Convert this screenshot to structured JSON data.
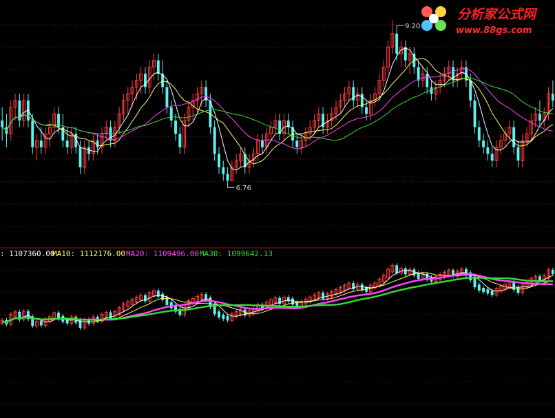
{
  "watermark": {
    "title": "分析家公式网",
    "url": "www.88gs.com"
  },
  "colors": {
    "background": "#000000",
    "grid": "#7a1212",
    "divider": "#a01414",
    "up": "#ff3c3c",
    "down": "#5ff0f0",
    "ma_short": "#ffffff",
    "ma10": "#ffff66",
    "ma20": "#ff44ff",
    "ma30": "#33dd33",
    "annotation": "#d8d8d8",
    "watermark_title": "#ff2020",
    "watermark_url": "#ff3030"
  },
  "chart_data": [
    {
      "type": "candlestick",
      "panel": "price",
      "ylim": [
        6.0,
        9.4
      ],
      "annotations": [
        {
          "label": "9.20",
          "index": 91
        },
        {
          "label": "6.76",
          "index": 52
        }
      ],
      "candles": [
        [
          7.7,
          7.9,
          7.4,
          7.6
        ],
        [
          7.6,
          7.8,
          7.3,
          7.5
        ],
        [
          7.5,
          8.0,
          7.4,
          7.9
        ],
        [
          7.9,
          8.1,
          7.7,
          8.0
        ],
        [
          8.0,
          8.1,
          7.6,
          7.7
        ],
        [
          7.7,
          8.1,
          7.6,
          8.0
        ],
        [
          8.0,
          8.1,
          7.6,
          7.7
        ],
        [
          7.7,
          7.8,
          7.2,
          7.3
        ],
        [
          7.3,
          7.5,
          7.1,
          7.4
        ],
        [
          7.4,
          7.6,
          7.2,
          7.3
        ],
        [
          7.3,
          7.6,
          7.2,
          7.5
        ],
        [
          7.5,
          7.7,
          7.3,
          7.6
        ],
        [
          7.6,
          7.9,
          7.5,
          7.8
        ],
        [
          7.8,
          7.9,
          7.5,
          7.6
        ],
        [
          7.6,
          7.8,
          7.3,
          7.4
        ],
        [
          7.4,
          7.6,
          7.2,
          7.3
        ],
        [
          7.3,
          7.6,
          7.2,
          7.5
        ],
        [
          7.5,
          7.6,
          7.2,
          7.3
        ],
        [
          7.3,
          7.4,
          6.9,
          7.0
        ],
        [
          7.0,
          7.4,
          6.9,
          7.3
        ],
        [
          7.3,
          7.4,
          7.1,
          7.2
        ],
        [
          7.2,
          7.5,
          7.1,
          7.4
        ],
        [
          7.4,
          7.5,
          7.2,
          7.3
        ],
        [
          7.3,
          7.6,
          7.2,
          7.5
        ],
        [
          7.5,
          7.7,
          7.4,
          7.6
        ],
        [
          7.6,
          7.7,
          7.3,
          7.4
        ],
        [
          7.4,
          7.7,
          7.3,
          7.6
        ],
        [
          7.6,
          7.9,
          7.5,
          7.8
        ],
        [
          7.8,
          8.1,
          7.7,
          8.0
        ],
        [
          8.0,
          8.2,
          7.8,
          8.1
        ],
        [
          8.1,
          8.3,
          7.9,
          8.2
        ],
        [
          8.2,
          8.4,
          8.0,
          8.3
        ],
        [
          8.3,
          8.5,
          8.1,
          8.4
        ],
        [
          8.4,
          8.5,
          8.1,
          8.2
        ],
        [
          8.2,
          8.6,
          8.1,
          8.5
        ],
        [
          8.5,
          8.7,
          8.3,
          8.6
        ],
        [
          8.6,
          8.7,
          8.3,
          8.4
        ],
        [
          8.4,
          8.6,
          8.1,
          8.2
        ],
        [
          8.2,
          8.3,
          7.8,
          7.9
        ],
        [
          7.9,
          8.0,
          7.6,
          7.7
        ],
        [
          7.7,
          7.8,
          7.4,
          7.5
        ],
        [
          7.5,
          7.6,
          7.2,
          7.3
        ],
        [
          7.3,
          7.8,
          7.2,
          7.7
        ],
        [
          7.7,
          8.0,
          7.6,
          7.9
        ],
        [
          7.9,
          8.1,
          7.7,
          8.0
        ],
        [
          8.0,
          8.2,
          7.8,
          8.1
        ],
        [
          8.1,
          8.3,
          7.9,
          8.2
        ],
        [
          8.2,
          8.3,
          7.9,
          8.0
        ],
        [
          8.0,
          8.1,
          7.5,
          7.6
        ],
        [
          7.6,
          7.7,
          7.1,
          7.2
        ],
        [
          7.2,
          7.3,
          6.9,
          7.0
        ],
        [
          7.0,
          7.1,
          6.8,
          6.9
        ],
        [
          6.9,
          7.0,
          6.76,
          6.8
        ],
        [
          6.8,
          7.1,
          6.8,
          7.0
        ],
        [
          7.0,
          7.2,
          6.9,
          7.1
        ],
        [
          7.1,
          7.3,
          7.0,
          7.2
        ],
        [
          7.2,
          7.3,
          6.9,
          7.0
        ],
        [
          7.0,
          7.2,
          6.9,
          7.1
        ],
        [
          7.1,
          7.3,
          7.0,
          7.2
        ],
        [
          7.2,
          7.5,
          7.1,
          7.4
        ],
        [
          7.4,
          7.5,
          7.2,
          7.3
        ],
        [
          7.3,
          7.6,
          7.2,
          7.5
        ],
        [
          7.5,
          7.7,
          7.4,
          7.6
        ],
        [
          7.6,
          7.8,
          7.5,
          7.7
        ],
        [
          7.7,
          7.8,
          7.4,
          7.5
        ],
        [
          7.5,
          7.8,
          7.4,
          7.7
        ],
        [
          7.7,
          7.8,
          7.5,
          7.6
        ],
        [
          7.6,
          7.7,
          7.3,
          7.4
        ],
        [
          7.4,
          7.5,
          7.2,
          7.3
        ],
        [
          7.3,
          7.5,
          7.2,
          7.4
        ],
        [
          7.4,
          7.6,
          7.3,
          7.5
        ],
        [
          7.5,
          7.7,
          7.4,
          7.6
        ],
        [
          7.6,
          7.8,
          7.5,
          7.7
        ],
        [
          7.7,
          7.9,
          7.6,
          7.8
        ],
        [
          7.8,
          7.9,
          7.5,
          7.6
        ],
        [
          7.6,
          7.8,
          7.5,
          7.7
        ],
        [
          7.7,
          7.9,
          7.6,
          7.8
        ],
        [
          7.8,
          8.0,
          7.7,
          7.9
        ],
        [
          7.9,
          8.1,
          7.8,
          8.0
        ],
        [
          8.0,
          8.2,
          7.9,
          8.1
        ],
        [
          8.1,
          8.3,
          8.0,
          8.2
        ],
        [
          8.2,
          8.3,
          7.9,
          8.0
        ],
        [
          8.0,
          8.2,
          7.9,
          8.1
        ],
        [
          8.1,
          8.2,
          7.8,
          7.9
        ],
        [
          7.9,
          8.0,
          7.7,
          7.8
        ],
        [
          7.8,
          8.1,
          7.7,
          8.0
        ],
        [
          8.0,
          8.2,
          7.9,
          8.1
        ],
        [
          8.1,
          8.4,
          8.0,
          8.3
        ],
        [
          8.3,
          8.6,
          8.2,
          8.5
        ],
        [
          8.5,
          8.9,
          8.4,
          8.8
        ],
        [
          8.8,
          9.2,
          8.7,
          9.0
        ],
        [
          9.0,
          9.1,
          8.6,
          8.7
        ],
        [
          8.7,
          8.9,
          8.5,
          8.8
        ],
        [
          8.8,
          8.9,
          8.5,
          8.6
        ],
        [
          8.6,
          8.8,
          8.4,
          8.7
        ],
        [
          8.7,
          8.8,
          8.4,
          8.5
        ],
        [
          8.5,
          8.6,
          8.2,
          8.3
        ],
        [
          8.3,
          8.5,
          8.2,
          8.4
        ],
        [
          8.4,
          8.5,
          8.1,
          8.2
        ],
        [
          8.2,
          8.3,
          8.0,
          8.1
        ],
        [
          8.1,
          8.3,
          8.0,
          8.2
        ],
        [
          8.2,
          8.4,
          8.1,
          8.3
        ],
        [
          8.3,
          8.5,
          8.2,
          8.4
        ],
        [
          8.4,
          8.6,
          8.3,
          8.5
        ],
        [
          8.5,
          8.6,
          8.2,
          8.3
        ],
        [
          8.3,
          8.5,
          8.2,
          8.4
        ],
        [
          8.4,
          8.6,
          8.3,
          8.5
        ],
        [
          8.5,
          8.6,
          8.2,
          8.3
        ],
        [
          8.3,
          8.4,
          7.9,
          8.0
        ],
        [
          8.0,
          8.1,
          7.5,
          7.6
        ],
        [
          7.6,
          7.7,
          7.3,
          7.4
        ],
        [
          7.4,
          7.5,
          7.2,
          7.3
        ],
        [
          7.3,
          7.4,
          7.1,
          7.2
        ],
        [
          7.2,
          7.3,
          7.0,
          7.1
        ],
        [
          7.1,
          7.4,
          7.0,
          7.3
        ],
        [
          7.3,
          7.5,
          7.2,
          7.4
        ],
        [
          7.4,
          7.6,
          7.3,
          7.5
        ],
        [
          7.5,
          7.7,
          7.4,
          7.6
        ],
        [
          7.6,
          7.7,
          7.2,
          7.3
        ],
        [
          7.3,
          7.4,
          7.0,
          7.1
        ],
        [
          7.1,
          7.5,
          7.0,
          7.4
        ],
        [
          7.4,
          7.6,
          7.3,
          7.5
        ],
        [
          7.5,
          7.8,
          7.4,
          7.7
        ],
        [
          7.7,
          7.9,
          7.6,
          7.8
        ],
        [
          7.8,
          8.0,
          7.6,
          7.7
        ],
        [
          7.7,
          7.9,
          7.6,
          7.8
        ],
        [
          7.8,
          8.2,
          7.7,
          8.1
        ],
        [
          8.1,
          8.3,
          7.9,
          8.0
        ]
      ]
    },
    {
      "type": "line",
      "panel": "volume-ma",
      "legend": [
        {
          "label": ": 1107360.00",
          "color_key": "ma_short"
        },
        {
          "label": "MA10: 1112176.00",
          "color_key": "ma10"
        },
        {
          "label": "MA20: 1109496.00",
          "color_key": "ma20"
        },
        {
          "label": "MA30: 1099642.13",
          "color_key": "ma30"
        }
      ]
    }
  ]
}
